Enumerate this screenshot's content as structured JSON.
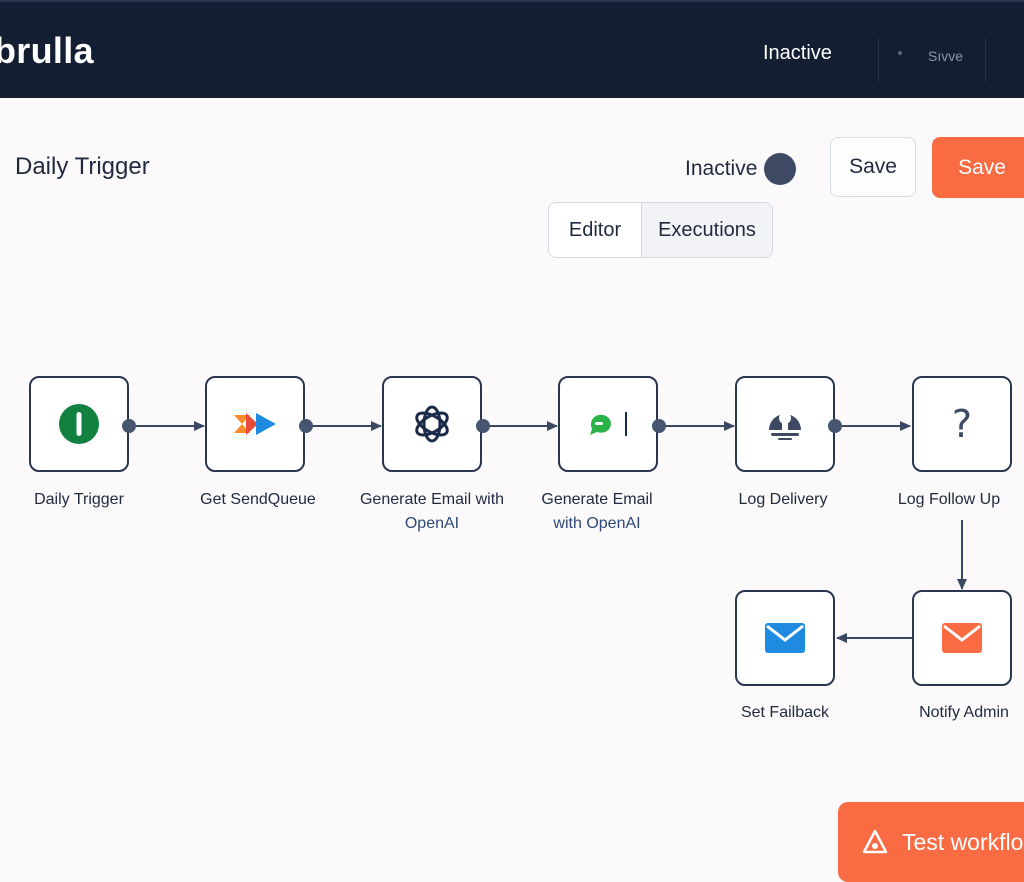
{
  "app": {
    "name": "brulla"
  },
  "topbar": {
    "status": "Inactive",
    "save_label": "Sıvve"
  },
  "workflow": {
    "title": "Daily Trigger",
    "status_label": "Inactive",
    "save_outline_label": "Save",
    "save_primary_label": "Save",
    "tabs": [
      {
        "label": "Editor",
        "active": true
      },
      {
        "label": "Executions",
        "active": false
      }
    ]
  },
  "nodes": [
    {
      "id": "daily-trigger",
      "label_line1": "Daily Trigger",
      "label_line2": "",
      "icon": "power-icon"
    },
    {
      "id": "get-sendqueue",
      "label_line1": "Get SendQueue",
      "label_line2": "",
      "icon": "sendqueue-icon"
    },
    {
      "id": "generate-email-openai-1",
      "label_line1": "Generate Email with",
      "label_line2": "OpenAI",
      "icon": "openai-icon"
    },
    {
      "id": "generate-email-openai-2",
      "label_line1": "Generate Email",
      "label_line2": "with OpenAI",
      "icon": "chat-bubble-icon"
    },
    {
      "id": "log-delivery",
      "label_line1": "Log Delivery",
      "label_line2": "",
      "icon": "lamp-icon"
    },
    {
      "id": "log-follow-up",
      "label_line1": "Log Follow Up",
      "label_line2": "",
      "icon": "question-icon"
    },
    {
      "id": "notify-admin",
      "label_line1": "Notify Admin",
      "label_line2": "",
      "icon": "mail-icon"
    },
    {
      "id": "set-failback",
      "label_line1": "Set Failback",
      "label_line2": "",
      "icon": "mail-icon"
    }
  ],
  "colors": {
    "accent": "#f86b43",
    "topbar": "#141e33",
    "node_border": "#2a3550",
    "green": "#12813f",
    "blue": "#1f8be0"
  },
  "test_button": {
    "label": "Test workflo"
  }
}
